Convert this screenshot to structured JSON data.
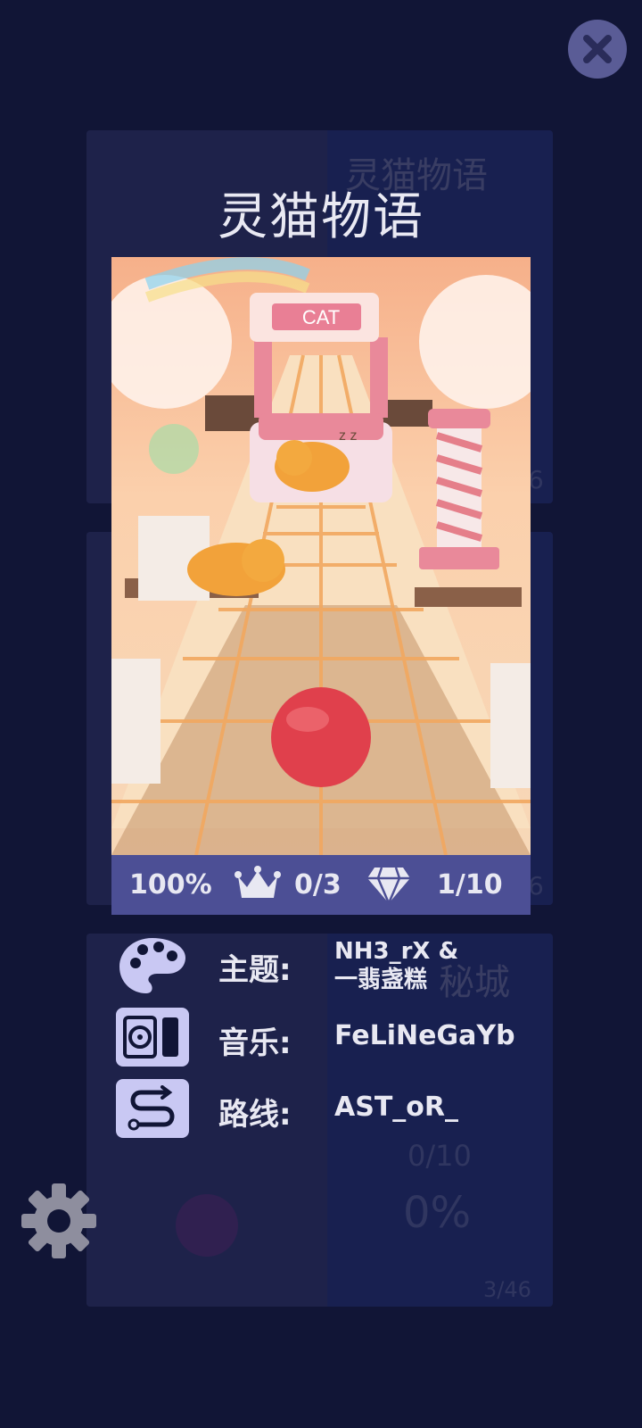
{
  "dialog": {
    "title": "灵猫物语",
    "preview": {
      "logo_text": "CAT",
      "sleep_text": "z z"
    },
    "stats": {
      "progress": "100%",
      "crowns": "0/3",
      "gems": "1/10"
    },
    "credits": [
      {
        "label": "主题:",
        "value_line1": "NH3_rX &",
        "value_line2": "一翡盏糕",
        "icon": "palette-icon"
      },
      {
        "label": "音乐:",
        "value_line1": "FeLiNeGaYb",
        "value_line2": "",
        "icon": "music-player-icon"
      },
      {
        "label": "路线:",
        "value_line1": "AST_oR_",
        "value_line2": "",
        "icon": "route-icon"
      }
    ]
  },
  "background": {
    "card1_title": "灵猫物语",
    "card3_title": "秘城",
    "card3_gems": "0/10",
    "card3_progress": "0%",
    "card3_page": "3/46",
    "card1_page_fragment": "6",
    "card2_page_fragment": "6"
  },
  "colors": {
    "background": "#111536",
    "stats_bar": "#4c4f95",
    "icon_bg": "#c9c8f3",
    "ball": "#e0404c"
  }
}
